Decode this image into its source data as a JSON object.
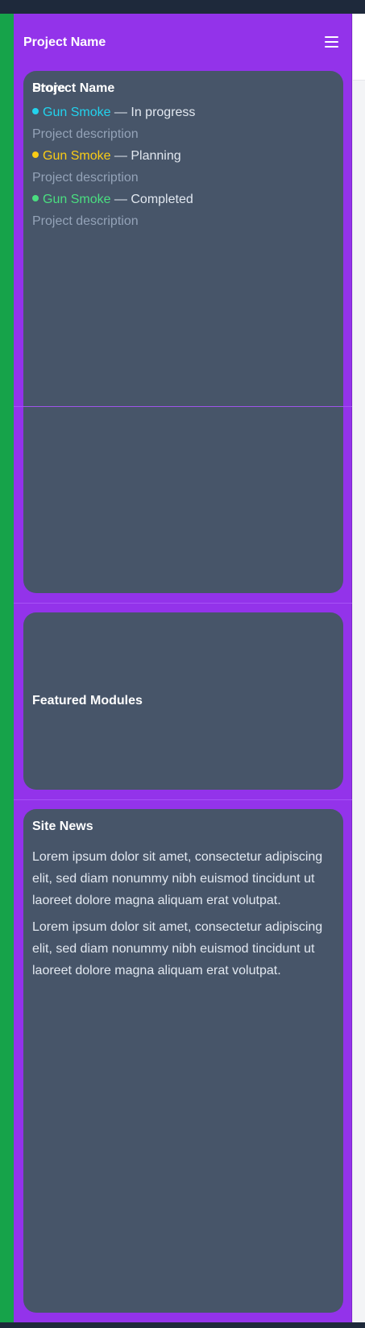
{
  "sidebar": {
    "brand": "Project Name",
    "menu_icon": "hamburger-icon"
  },
  "projects_card": {
    "title": "Project Name",
    "items": [
      {
        "name": "Gun Smoke",
        "status": "In progress",
        "color": "#22d3ee",
        "description": "Project description"
      },
      {
        "name": "Gun Smoke",
        "status": "Planning",
        "color": "#facc15",
        "description": "Project description"
      },
      {
        "name": "Gun Smoke",
        "status": "Completed",
        "color": "#4ade80",
        "description": "Project description"
      }
    ],
    "separator": " — "
  },
  "store": {
    "title": "Store"
  },
  "featured": {
    "title": "Featured Modules"
  },
  "news": {
    "title": "Site News",
    "paragraphs": [
      "Lorem ipsum dolor sit amet, consectetur adipiscing elit, sed diam nonummy nibh euismod tincidunt ut laoreet dolore magna aliquam erat volutpat.",
      "Lorem ipsum dolor sit amet, consectetur adipiscing elit, sed diam nonummy nibh euismod tincidunt ut laoreet dolore magna aliquam erat volutpat."
    ]
  },
  "colors": {
    "sidebar_bg": "#9333ea",
    "card_bg": "#475569",
    "rail_green": "#16a34a",
    "topbar": "#1e293b"
  }
}
